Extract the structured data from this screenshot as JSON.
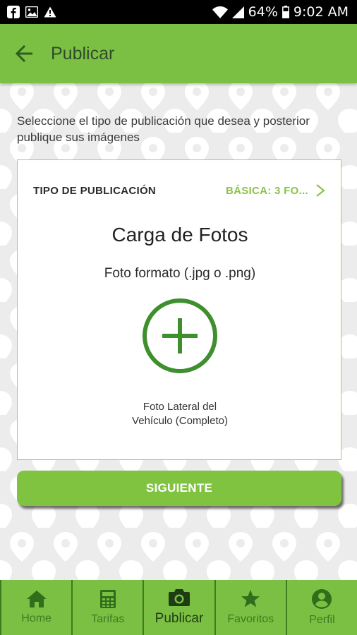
{
  "status_bar": {
    "battery": "64%",
    "time": "9:02 AM",
    "left_icons": [
      "facebook-icon",
      "image-icon",
      "warning-icon"
    ],
    "right_icons": [
      "wifi-icon",
      "signal-icon",
      "battery-icon"
    ]
  },
  "app_bar": {
    "title": "Publicar",
    "back_icon": "arrow-left-icon"
  },
  "intro_text": "Seleccione el tipo de publicación que desea y posterior publique sus imágenes",
  "card": {
    "type_label": "TIPO DE PUBLICACIÓN",
    "type_value": "BÁSICA: 3 FO...",
    "title": "Carga de Fotos",
    "subtitle": "Foto formato (.jpg o .png)",
    "caption_line1": "Foto Lateral del",
    "caption_line2": "Vehículo (Completo)"
  },
  "next_button": "SIGUIENTE",
  "bottom_nav": [
    {
      "label": "Home",
      "icon": "home-icon",
      "active": false
    },
    {
      "label": "Tarifas",
      "icon": "calculator-icon",
      "active": false
    },
    {
      "label": "Publicar",
      "icon": "camera-icon",
      "active": true
    },
    {
      "label": "Favoritos",
      "icon": "star-icon",
      "active": false
    },
    {
      "label": "Perfil",
      "icon": "account-icon",
      "active": false
    }
  ],
  "colors": {
    "primary_green": "#7bc043",
    "accent_green": "#8ac34a",
    "dark_green": "#2f5f1e"
  }
}
